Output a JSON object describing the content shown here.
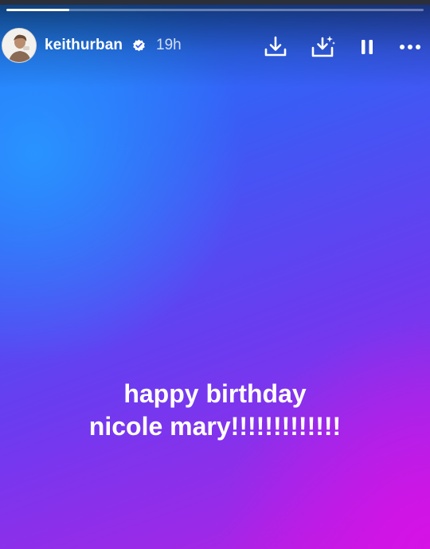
{
  "story": {
    "progress": 0.15
  },
  "header": {
    "username": "keithurban",
    "time": "19h",
    "verified": true,
    "icons": {
      "avatar": "profile-photo",
      "verified": "verified-badge-icon",
      "download": "download-icon",
      "save": "save-to-icon",
      "pause": "pause-icon",
      "more": "more-options-icon"
    }
  },
  "caption": {
    "line1": "happy birthday",
    "line2": "nicole mary!!!!!!!!!!!!!"
  },
  "colors": {
    "top_left": "#1a7fff",
    "bottom_right": "#d612e6",
    "mid": "#6a3cf0"
  }
}
